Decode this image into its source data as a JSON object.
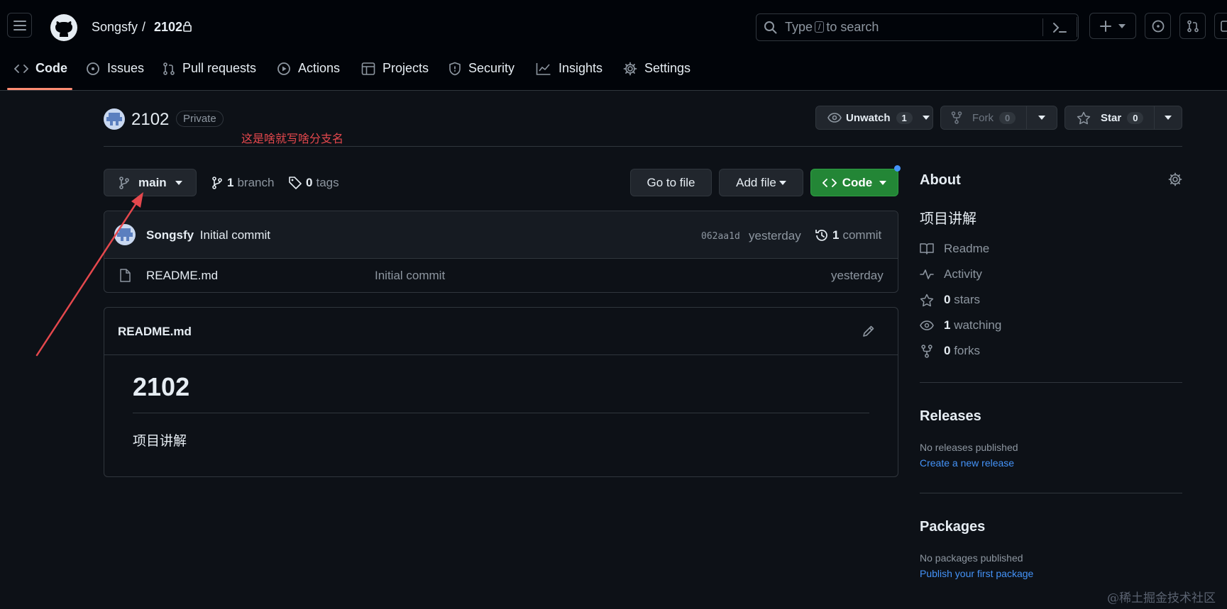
{
  "header": {
    "owner": "Songsfy",
    "separator": "/",
    "repo": "2102",
    "search": {
      "before": "Type",
      "key": "/",
      "after": "to search"
    }
  },
  "tabs": [
    {
      "label": "Code",
      "icon": "code-icon"
    },
    {
      "label": "Issues",
      "icon": "issue-icon"
    },
    {
      "label": "Pull requests",
      "icon": "pull-request-icon"
    },
    {
      "label": "Actions",
      "icon": "play-icon"
    },
    {
      "label": "Projects",
      "icon": "table-icon"
    },
    {
      "label": "Security",
      "icon": "shield-icon"
    },
    {
      "label": "Insights",
      "icon": "graph-icon"
    },
    {
      "label": "Settings",
      "icon": "gear-icon"
    }
  ],
  "repo": {
    "name": "2102",
    "visibility": "Private",
    "annotation": "这是啥就写啥分支名",
    "unwatch": {
      "label": "Unwatch",
      "count": "1"
    },
    "fork": {
      "label": "Fork",
      "count": "0"
    },
    "star": {
      "label": "Star",
      "count": "0"
    }
  },
  "toolbar": {
    "branch": "main",
    "branches_count": "1",
    "branches_label": "branch",
    "tags_count": "0",
    "tags_label": "tags",
    "go_to_file": "Go to file",
    "add_file": "Add file",
    "code": "Code"
  },
  "commit": {
    "author": "Songsfy",
    "message": "Initial commit",
    "sha": "062aa1d",
    "time": "yesterday",
    "count": "1",
    "count_label": "commit"
  },
  "files": [
    {
      "name": "README.md",
      "message": "Initial commit",
      "time": "yesterday"
    }
  ],
  "readme": {
    "filename": "README.md",
    "heading": "2102",
    "body": "项目讲解"
  },
  "about": {
    "title": "About",
    "description": "项目讲解",
    "readme": "Readme",
    "activity": "Activity",
    "stars_count": "0",
    "stars_label": "stars",
    "watching_count": "1",
    "watching_label": "watching",
    "forks_count": "0",
    "forks_label": "forks"
  },
  "releases": {
    "title": "Releases",
    "empty": "No releases published",
    "link": "Create a new release"
  },
  "packages": {
    "title": "Packages",
    "empty": "No packages published",
    "link": "Publish your first package"
  },
  "watermark": "@稀土掘金技术社区",
  "colors": {
    "background": "#0d1117",
    "header_bg": "#010409",
    "code_button": "#238636",
    "link": "#4493f8",
    "annotation": "#e5484d",
    "tab_underline": "#fd8c73"
  }
}
